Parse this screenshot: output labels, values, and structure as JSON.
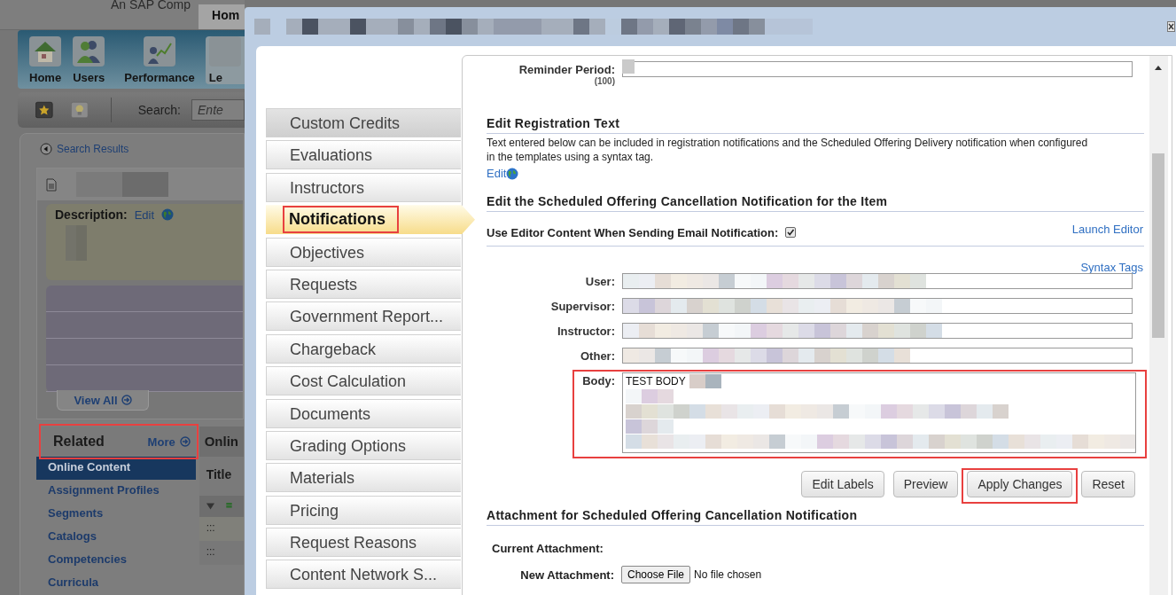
{
  "background_page": {
    "brand": "An SAP Comp",
    "top_tab": "Hom",
    "nav": [
      {
        "label": "Home",
        "kind": "home"
      },
      {
        "label": "Users",
        "kind": "users"
      },
      {
        "label": "Performance",
        "kind": "performance"
      },
      {
        "label": "Le",
        "kind": "partial"
      }
    ],
    "search": {
      "label": "Search:",
      "placeholder": "Ente"
    },
    "back_link": "Search Results",
    "description": {
      "label": "Description:",
      "edit_link": "Edit"
    },
    "view_all": "View All",
    "related": {
      "title": "Related",
      "more": "More",
      "items": [
        {
          "label": "Online Content",
          "selected": true
        },
        {
          "label": "Assignment Profiles",
          "selected": false
        },
        {
          "label": "Segments",
          "selected": false
        },
        {
          "label": "Catalogs",
          "selected": false
        },
        {
          "label": "Competencies",
          "selected": false
        },
        {
          "label": "Curricula",
          "selected": false
        }
      ]
    },
    "content_table": {
      "title": "Onlin",
      "column": "Title",
      "rows": [
        ":::",
        ":::"
      ]
    }
  },
  "dialog": {
    "tabs": [
      {
        "label": "Custom Credits",
        "selected": false
      },
      {
        "label": "Evaluations",
        "selected": false
      },
      {
        "label": "Instructors",
        "selected": false
      },
      {
        "label": "Notifications",
        "selected": true
      },
      {
        "label": "Objectives",
        "selected": false
      },
      {
        "label": "Requests",
        "selected": false
      },
      {
        "label": "Government Report...",
        "selected": false
      },
      {
        "label": "Chargeback",
        "selected": false
      },
      {
        "label": "Cost Calculation",
        "selected": false
      },
      {
        "label": "Documents",
        "selected": false
      },
      {
        "label": "Grading Options",
        "selected": false
      },
      {
        "label": "Materials",
        "selected": false
      },
      {
        "label": "Pricing",
        "selected": false
      },
      {
        "label": "Request Reasons",
        "selected": false
      },
      {
        "label": "Content Network S...",
        "selected": false
      }
    ],
    "reminder": {
      "label": "Reminder Period:",
      "hint": "(100)"
    },
    "registration": {
      "heading": "Edit Registration Text",
      "text": "Text entered below can be included in registration notifications and the Scheduled Offering Delivery notification when configured in the templates using a syntax tag.",
      "edit_link": "Edit"
    },
    "cancellation": {
      "heading": "Edit the Scheduled Offering Cancellation Notification for the Item",
      "use_editor": {
        "label": "Use Editor Content When Sending Email Notification:",
        "checked": true
      },
      "launch_editor": "Launch Editor",
      "syntax_tags": "Syntax Tags",
      "fields": [
        {
          "label": "User:"
        },
        {
          "label": "Supervisor:"
        },
        {
          "label": "Instructor:"
        },
        {
          "label": "Other:"
        }
      ],
      "body": {
        "label": "Body:",
        "value": "TEST BODY"
      },
      "buttons": [
        "Edit Labels",
        "Preview",
        "Apply Changes",
        "Reset"
      ]
    },
    "attachment": {
      "heading": "Attachment for Scheduled Offering Cancellation Notification",
      "current_label": "Current Attachment:",
      "new_label": "New Attachment:",
      "choose_button": "Choose File",
      "file_status": "No file chosen"
    }
  }
}
